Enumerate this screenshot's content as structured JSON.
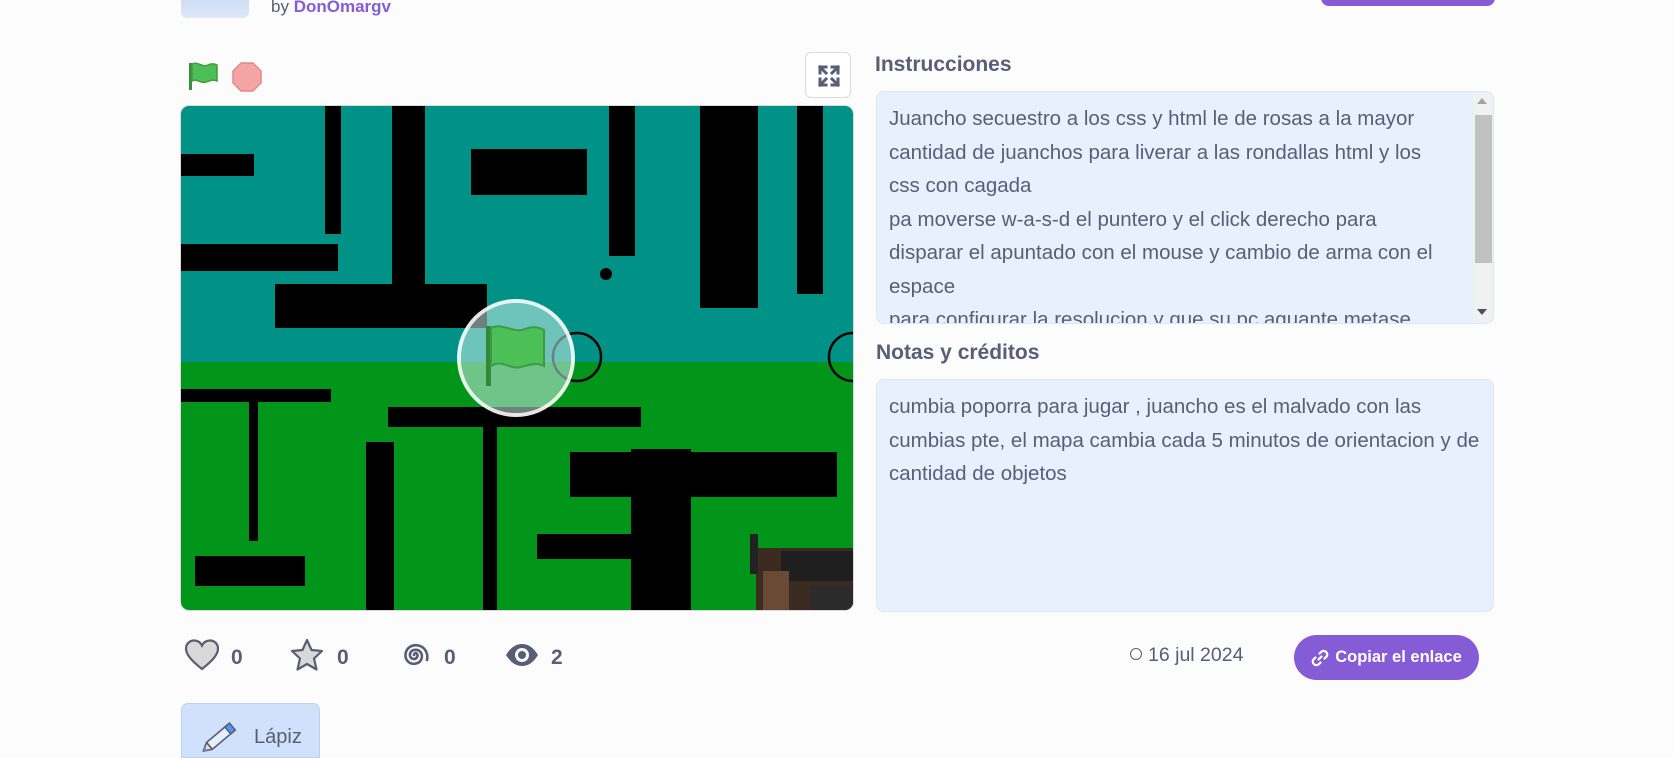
{
  "project": {
    "by_prefix": "by",
    "author": "DonOmargv"
  },
  "controls": {
    "green_flag_icon": "green-flag-icon",
    "stop_icon": "stop-icon",
    "fullscreen_icon": "fullscreen-icon"
  },
  "instructions": {
    "title": "Instrucciones",
    "text": "Juancho secuestro a los css y html le de rosas a la mayor cantidad de juanchos para liverar a las rondallas html y los css con cagada\npa moverse w-a-s-d el puntero y el click derecho para disparar el apuntado con el mouse y cambio de arma con el espace\npara configurar la resolucion y que su pc aguante metase"
  },
  "notes": {
    "title": "Notas y créditos",
    "text": "cumbia poporra para jugar , juancho es el malvado con las cumbias pte, el mapa cambia cada 5 minutos de orientacion y de cantidad de objetos"
  },
  "stats": {
    "loves": "0",
    "favorites": "0",
    "remixes": "0",
    "views": "2"
  },
  "date": "16 jul 2024",
  "copy_link_label": "Copiar el enlace",
  "extension": {
    "label": "Lápiz",
    "icon": "pencil-icon"
  },
  "colors": {
    "accent": "#855cd6",
    "stage_sky": "#009287",
    "stage_grass": "#01951a",
    "panel_bg": "#e9f0fd"
  }
}
